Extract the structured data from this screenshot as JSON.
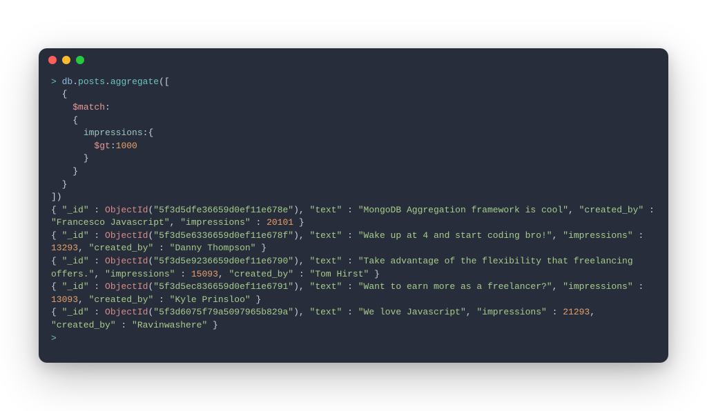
{
  "window": {
    "dots": [
      "red",
      "yellow",
      "green"
    ]
  },
  "prompt": ">",
  "cmd": {
    "db": "db",
    "coll": "posts",
    "method": "aggregate",
    "open": "([",
    "match_key": "$match",
    "impressions_key": "impressions",
    "gt_key": "$gt",
    "gt_val": "1000",
    "close": "])"
  },
  "docs": [
    {
      "_id": "5f3d5dfe36659d0ef11e678e",
      "text": "MongoDB Aggregation framework is cool",
      "extra_key": "created_by",
      "extra_val": "Francesco Javascript",
      "impressions": "20101",
      "order": "text_first"
    },
    {
      "_id": "5f3d5e6336659d0ef11e678f",
      "text": "Wake up at 4 and start coding bro!",
      "impressions": "13293",
      "extra_key": "created_by",
      "extra_val": "Danny Thompson",
      "order": "text_first_imp_before_extra"
    },
    {
      "_id": "5f3d5e9236659d0ef11e6790",
      "text": "Take advantage of the flexibility that freelancing offers.",
      "impressions": "15093",
      "extra_key": "created_by",
      "extra_val": "Tom Hirst",
      "order": "text_first_imp_before_extra"
    },
    {
      "_id": "5f3d5ec836659d0ef11e6791",
      "text": "Want to earn more as a freelancer?",
      "impressions": "13093",
      "extra_key": "created_by",
      "extra_val": "Kyle Prinsloo",
      "order": "text_first_imp_before_extra"
    },
    {
      "_id": "5f3d6075f79a5097965b829a",
      "text": "We love Javascript",
      "impressions": "21293",
      "extra_key": "created_by",
      "extra_val": "Ravinwashere",
      "order": "text_first_imp_before_extra"
    }
  ],
  "labels": {
    "id": "\"_id\"",
    "text": "\"text\"",
    "impressions": "\"impressions\"",
    "objectid": "ObjectId"
  }
}
